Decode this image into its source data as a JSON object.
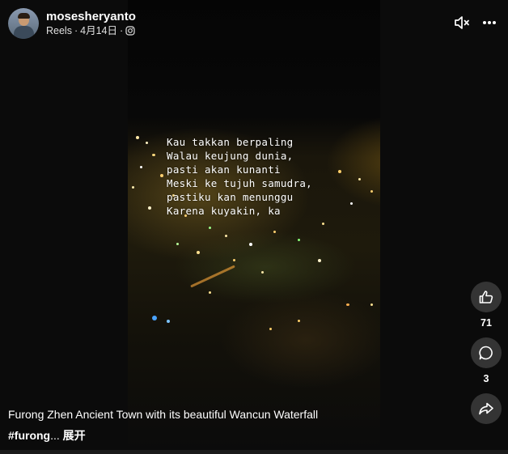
{
  "header": {
    "username": "mosesheryanto",
    "sub_type": "Reels",
    "sub_separator": "·",
    "sub_date": "4月14日",
    "sub_separator2": "·"
  },
  "video": {
    "lyrics": [
      "Kau takkan berpaling",
      "Walau keujung dunia,",
      "pasti akan kunanti",
      "Meski ke tujuh samudra,",
      "pastiku kan menunggu",
      "Karena kuyakin, ka"
    ]
  },
  "actions": {
    "like_count": "71",
    "comment_count": "3"
  },
  "caption": {
    "text": "Furong Zhen Ancient Town with its beautiful Wancun Waterfall",
    "hashtag": "#furong",
    "ellipsis": "...",
    "more_label": "展开"
  },
  "icons": {
    "mute": "speaker-muted-icon",
    "more": "more-options-icon",
    "instagram": "instagram-icon",
    "like": "thumbs-up-icon",
    "comment": "comment-icon",
    "share": "share-icon"
  }
}
